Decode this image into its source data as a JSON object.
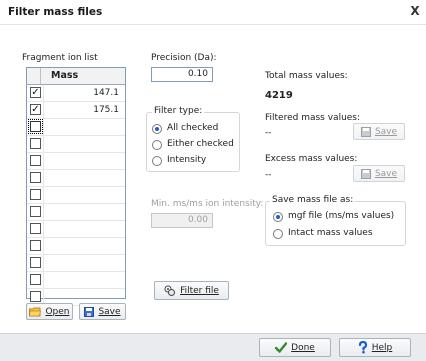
{
  "window": {
    "title": "Filter mass files",
    "close_glyph": "X"
  },
  "fragment_list": {
    "label": "Fragment ion list",
    "column_header": "Mass",
    "rows": [
      {
        "checked": true,
        "mass": "147.1"
      },
      {
        "checked": true,
        "mass": "175.1"
      },
      {
        "checked": false,
        "mass": "",
        "focused": true
      },
      {
        "checked": false,
        "mass": ""
      },
      {
        "checked": false,
        "mass": ""
      },
      {
        "checked": false,
        "mass": ""
      },
      {
        "checked": false,
        "mass": ""
      },
      {
        "checked": false,
        "mass": ""
      },
      {
        "checked": false,
        "mass": ""
      },
      {
        "checked": false,
        "mass": ""
      },
      {
        "checked": false,
        "mass": ""
      },
      {
        "checked": false,
        "mass": ""
      },
      {
        "checked": false,
        "mass": ""
      }
    ],
    "open_label": "Open",
    "save_label": "Save"
  },
  "precision": {
    "label": "Precision (Da):",
    "value": "0.10"
  },
  "filter_type": {
    "label": "Filter type:",
    "options": [
      "All checked",
      "Either checked",
      "Intensity"
    ],
    "selected": "All checked"
  },
  "min_msms": {
    "label": "Min. ms/ms ion intensity:",
    "value": "0.00"
  },
  "filter_button": "Filter file",
  "stats": {
    "total_label": "Total mass values:",
    "total_value": "4219",
    "filtered_label": "Filtered mass values:",
    "filtered_value": "--",
    "excess_label": "Excess mass values:",
    "excess_value": "--",
    "save_label": "Save"
  },
  "save_as": {
    "label": "Save mass file as:",
    "options": [
      "mgf file (ms/ms values)",
      "Intact mass values"
    ],
    "selected": "mgf file (ms/ms values)"
  },
  "bottom": {
    "done_label": "Done",
    "help_label": "Help"
  },
  "colors": {
    "accent": "#1d5fc9",
    "check_green": "#2e8b2e",
    "help_blue": "#1a5fd0"
  }
}
